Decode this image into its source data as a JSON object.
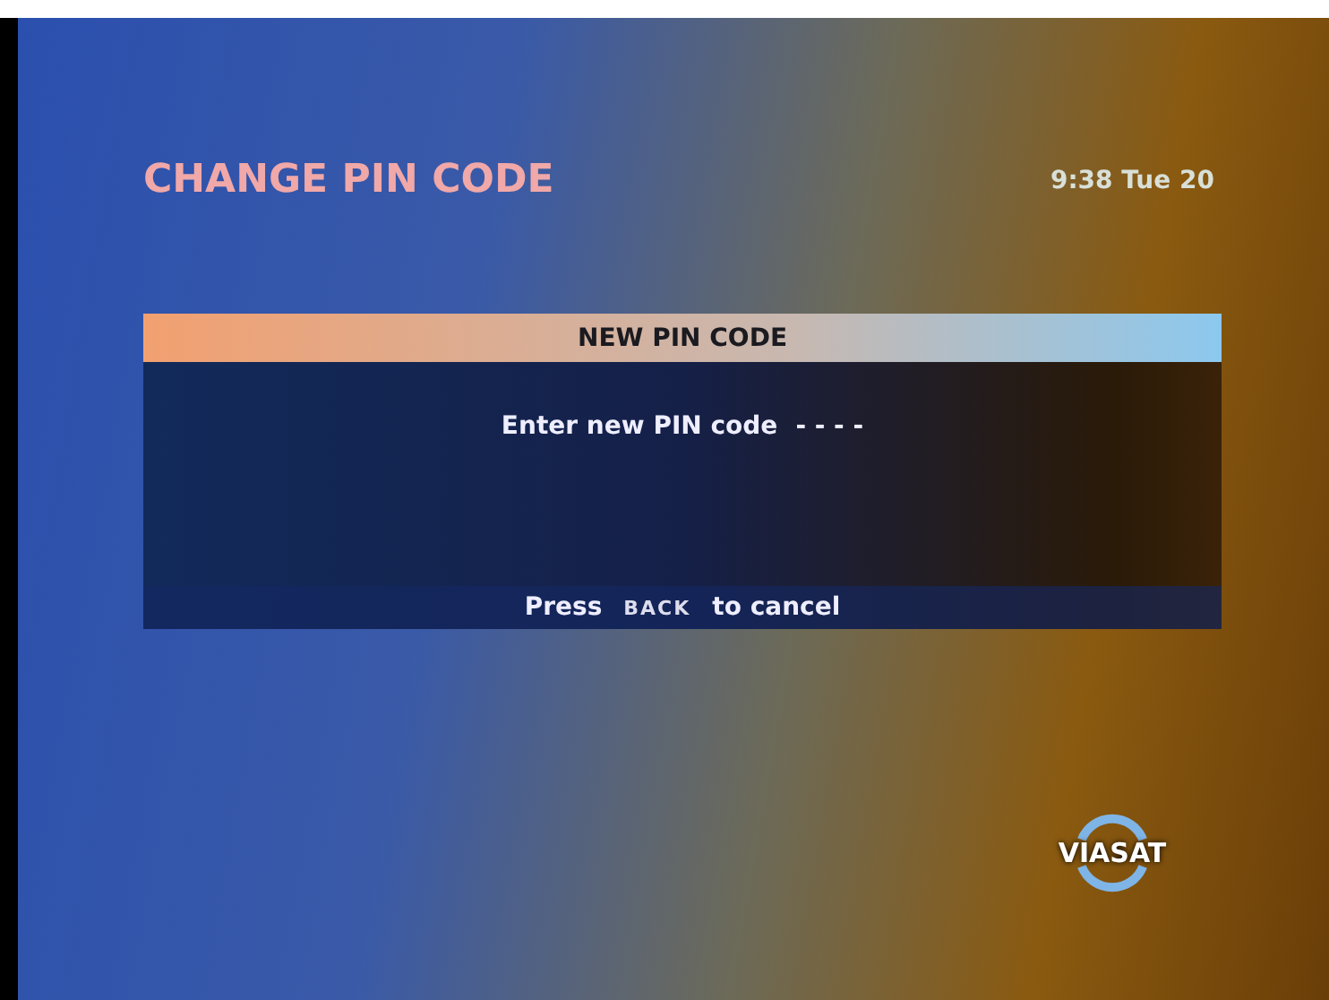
{
  "header": {
    "title": "CHANGE PIN CODE",
    "clock": "9:38 Tue 20"
  },
  "dialog": {
    "title": "NEW PIN CODE",
    "prompt": "Enter new PIN code",
    "pin_entry": "- - - -",
    "footer": {
      "before": "Press",
      "key": "BACK",
      "after": "to cancel"
    }
  },
  "logo": {
    "text": "VIASAT"
  }
}
